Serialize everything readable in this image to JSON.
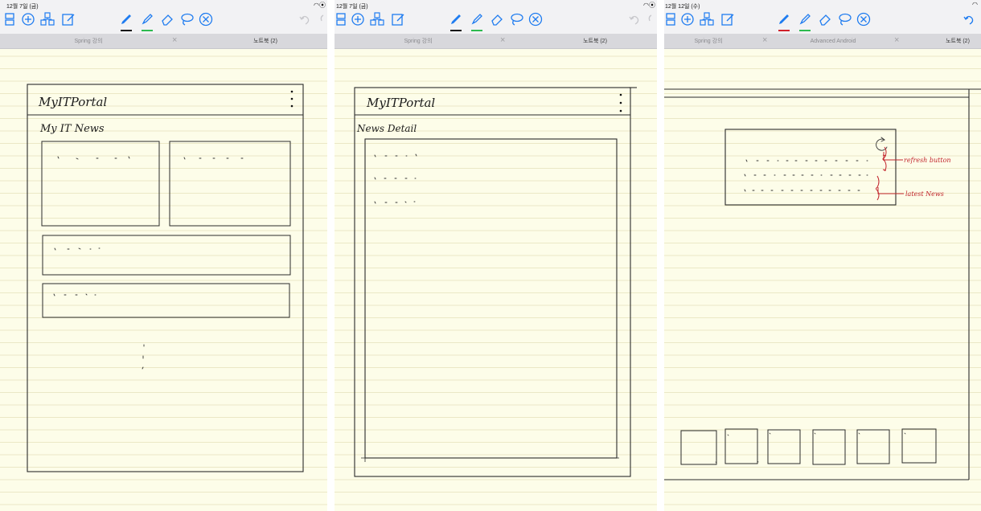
{
  "panels": [
    {
      "status_time": "12월 7일 (금)",
      "tabs": [
        {
          "label": "Spring 강의",
          "active": false
        },
        {
          "label": "노트북 (2)",
          "active": true
        }
      ],
      "sketch": {
        "app_title": "MyITPortal",
        "heading": "My IT News"
      }
    },
    {
      "status_time": "12월 7일 (금)",
      "tabs": [
        {
          "label": "Spring 강의",
          "active": false
        },
        {
          "label": "노트북 (2)",
          "active": true
        }
      ],
      "sketch": {
        "app_title": "MyITPortal",
        "heading": "News Detail"
      }
    },
    {
      "status_time": "12월 12일 (수)",
      "tabs": [
        {
          "label": "Spring 강의",
          "active": false
        },
        {
          "label": "Advanced Android",
          "active": false
        },
        {
          "label": "노트북 (2)",
          "active": true
        }
      ],
      "sketch": {
        "annotation_refresh": "refresh button",
        "annotation_news": "latest News"
      }
    }
  ],
  "tool_colors": {
    "pen_black": "#111111",
    "pen_red": "#d0202a",
    "highlighter_green": "#2dbb4f",
    "accent_blue": "#1f7cf0",
    "ink_red": "#c2262e",
    "paper": "#fdfde9"
  },
  "icons": [
    "page-layout-icon",
    "add-page-icon",
    "shapes-icon",
    "edit-page-icon",
    "pen-icon",
    "highlighter-icon",
    "eraser-icon",
    "lasso-icon",
    "close-circle-icon",
    "undo-icon",
    "wifi-icon"
  ]
}
